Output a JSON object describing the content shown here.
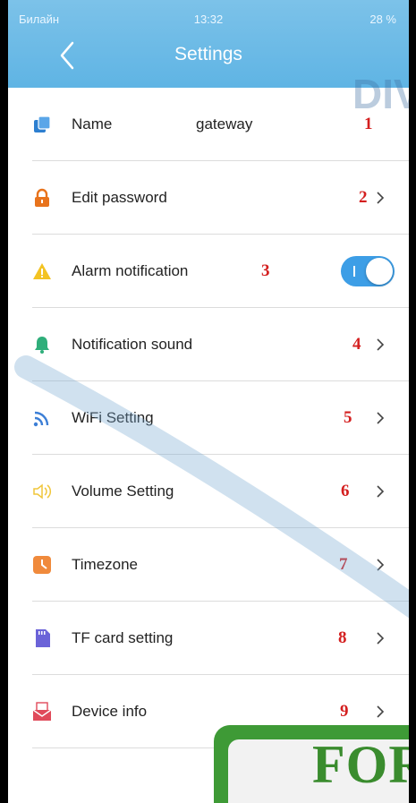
{
  "status_bar": {
    "carrier": "Билайн",
    "time": "13:32",
    "battery": "28 %"
  },
  "header": {
    "title": "Settings"
  },
  "rows": [
    {
      "label": "Name",
      "value": "gateway",
      "number": "1"
    },
    {
      "label": "Edit password",
      "number": "2"
    },
    {
      "label": "Alarm notification",
      "number": "3",
      "toggle_on": true
    },
    {
      "label": "Notification sound",
      "number": "4"
    },
    {
      "label": "WiFi Setting",
      "number": "5"
    },
    {
      "label": "Volume Setting",
      "number": "6"
    },
    {
      "label": "Timezone",
      "number": "7"
    },
    {
      "label": "TF card setting",
      "number": "8"
    },
    {
      "label": "Device info",
      "number": "9"
    }
  ],
  "watermark": {
    "text": "DIV",
    "stamp_text": "FOR"
  },
  "colors": {
    "header": "#5fb4e4",
    "accent": "#3d9ee6",
    "marker": "#d41f1f"
  }
}
